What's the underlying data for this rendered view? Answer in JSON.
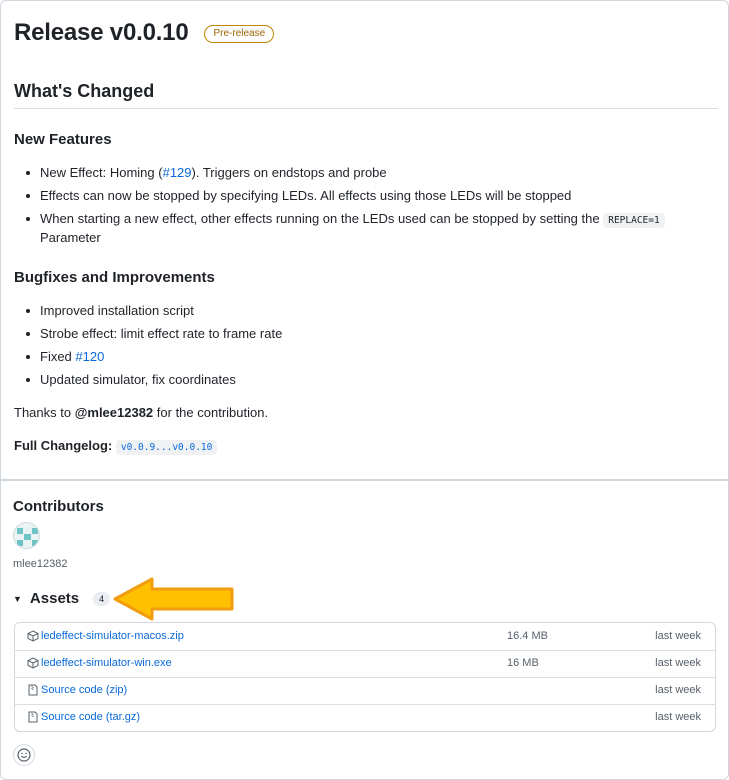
{
  "release": {
    "title": "Release v0.0.10",
    "badge": "Pre-release"
  },
  "body": {
    "heading": "What's Changed",
    "new_features": {
      "title": "New Features",
      "items": [
        {
          "pre": "New Effect: Homing (",
          "link": "#129",
          "post": "). Triggers on endstops and probe"
        },
        {
          "text": "Effects can now be stopped by specifying LEDs. All effects using those LEDs will be stopped"
        },
        {
          "text": "When starting a new effect, other effects running on the LEDs used can be stopped by setting the",
          "code": "REPLACE=1",
          "line2": "Parameter"
        }
      ]
    },
    "bugfixes": {
      "title": "Bugfixes and Improvements",
      "items": [
        {
          "text": "Improved installation script"
        },
        {
          "text": "Strobe effect: limit effect rate to frame rate"
        },
        {
          "pre": "Fixed ",
          "link": "#120"
        },
        {
          "text": "Updated simulator, fix coordinates"
        }
      ]
    },
    "thanks": {
      "pre": "Thanks to ",
      "user": "@mlee12382",
      "post": " for the contribution."
    },
    "changelog": {
      "label": "Full Changelog:",
      "value": "v0.0.9...v0.0.10"
    }
  },
  "contributors": {
    "title": "Contributors",
    "users": [
      {
        "name": "mlee12382"
      }
    ]
  },
  "assets": {
    "title": "Assets",
    "count": "4",
    "rows": [
      {
        "name": "ledeffect-simulator-macos.zip",
        "size": "16.4 MB",
        "date": "last week",
        "icon": "package-icon"
      },
      {
        "name": "ledeffect-simulator-win.exe",
        "size": "16 MB",
        "date": "last week",
        "icon": "package-icon"
      },
      {
        "name": "Source code (zip)",
        "size": "",
        "date": "last week",
        "icon": "file-zip-icon"
      },
      {
        "name": "Source code (tar.gz)",
        "size": "",
        "date": "last week",
        "icon": "file-zip-icon"
      }
    ]
  },
  "colors": {
    "accent": "#0969da",
    "badge": "#9a6700",
    "arrow_fill": "#ffc000",
    "arrow_stroke": "#f29c0f"
  }
}
